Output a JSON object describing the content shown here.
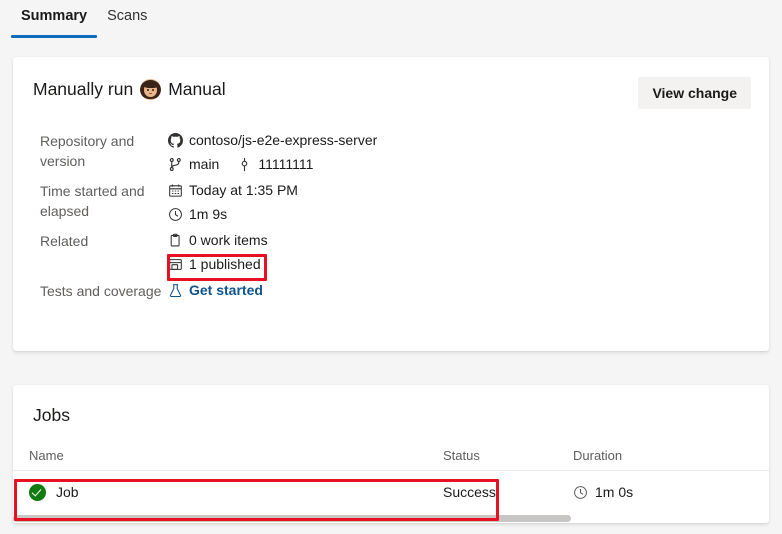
{
  "tabs": [
    {
      "label": "Summary",
      "active": true
    },
    {
      "label": "Scans",
      "active": false
    }
  ],
  "colors": {
    "accent": "#0f6cbd",
    "link": "#0f548c",
    "success": "#107c10",
    "annotation": "#e81123",
    "page_background": "#f5f5f5",
    "card_background": "#ffffff"
  },
  "summary": {
    "run_title": "Manually run",
    "trigger_actor": "Manual",
    "view_change_button": "View change",
    "rows": [
      {
        "label": "Repository and version",
        "values": [
          {
            "icon": "github-icon",
            "text": "contoso/js-e2e-express-server"
          }
        ],
        "pairs": [
          {
            "icon": "branch-icon",
            "text": "main"
          },
          {
            "icon": "commit-icon",
            "text": "11111111"
          }
        ]
      },
      {
        "label": "Time started and elapsed",
        "values": [
          {
            "icon": "calendar-icon",
            "text": "Today at 1:35 PM"
          },
          {
            "icon": "clock-icon",
            "text": "1m 9s"
          }
        ]
      },
      {
        "label": "Related",
        "values": [
          {
            "icon": "work-item-icon",
            "text": "0 work items"
          },
          {
            "icon": "artifact-icon",
            "text": "1 published",
            "highlighted": true
          }
        ]
      },
      {
        "label": "Tests and coverage",
        "values": [
          {
            "icon": "beaker-icon",
            "text": "Get started",
            "link": true
          }
        ]
      }
    ]
  },
  "jobs": {
    "title": "Jobs",
    "columns": [
      "Name",
      "Status",
      "Duration"
    ],
    "rows": [
      {
        "status_icon": "success-check-icon",
        "name": "Job",
        "status": "Success",
        "duration_icon": "clock-icon",
        "duration": "1m 0s",
        "highlighted": true
      }
    ]
  }
}
